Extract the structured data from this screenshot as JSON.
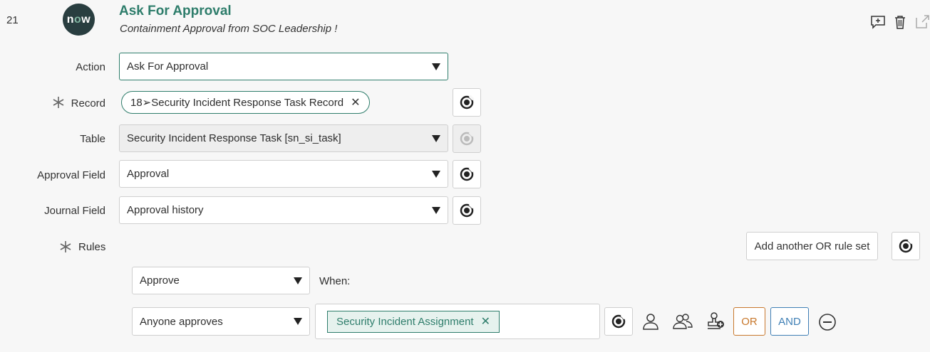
{
  "step": {
    "number": "21",
    "logo_text_a": "n",
    "logo_text_o": "o",
    "logo_text_w": "w",
    "title": "Ask For Approval",
    "subtitle": "Containment Approval from SOC Leadership !"
  },
  "header_icons": [
    "add-comment-icon",
    "trash-icon",
    "open-external-icon"
  ],
  "fields": {
    "action": {
      "label": "Action",
      "value": "Ask For Approval"
    },
    "record": {
      "label": "Record",
      "required": true,
      "pill": "18➢Security Incident Response Task Record",
      "remove": "✕"
    },
    "table": {
      "label": "Table",
      "value": "Security Incident Response Task [sn_si_task]",
      "readonly": true
    },
    "approval_field": {
      "label": "Approval Field",
      "value": "Approval"
    },
    "journal_field": {
      "label": "Journal Field",
      "value": "Approval history"
    }
  },
  "rules": {
    "label": "Rules",
    "required": true,
    "add_or_button": "Add another OR rule set",
    "rule_type": "Approve",
    "when_label": "When:",
    "condition": "Anyone approves",
    "approver_chip": "Security Incident Assignment",
    "chip_remove": "✕",
    "or_label": "OR",
    "and_label": "AND"
  },
  "colors": {
    "accent": "#2e7d6b",
    "or": "#c8782d",
    "and": "#3f7fb5",
    "logo_bg": "#293e40"
  }
}
